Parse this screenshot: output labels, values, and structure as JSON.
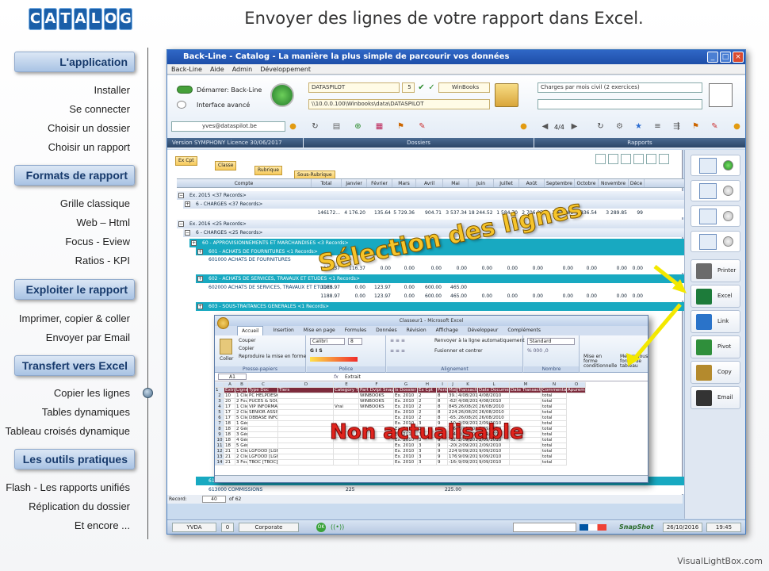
{
  "logo": {
    "letters": [
      "C",
      "A",
      "T",
      "A",
      "L",
      "O",
      "G"
    ]
  },
  "page_title": "Envoyer des lignes de votre rapport dans Excel.",
  "sidebar": {
    "sections": [
      {
        "title": "L'application",
        "items": [
          "Installer",
          "Se connecter",
          "Choisir un dossier",
          "Choisir un rapport"
        ]
      },
      {
        "title": "Formats de rapport",
        "items": [
          "Grille classique",
          "Web – Html",
          "Focus - Eview",
          "Ratios - KPI"
        ]
      },
      {
        "title": "Exploiter le rapport",
        "items": [
          "Imprimer, copier & coller",
          "Envoyer par Email"
        ]
      },
      {
        "title": "Transfert vers Excel",
        "items": [
          "Copier les lignes",
          "Tables dynamiques",
          "Tableau croisés dynamique"
        ]
      },
      {
        "title": "Les outils pratiques",
        "items": [
          "Flash - Les rapports unifiés",
          "Réplication du dossier",
          "Et encore ..."
        ]
      }
    ]
  },
  "app": {
    "title": "Back-Line - Catalog - La manière la plus simple de parcourir vos données",
    "menu": [
      "Back-Line",
      "Aide",
      "Admin",
      "Développement"
    ],
    "toggle_start": "Démarrer: Back-Line",
    "toggle_advanced": "Interface avancé",
    "email": "yves@dataspilot.be",
    "version": "Version SYMPHONY   Licence 30/06/2017",
    "dossier_name": "DATASPILOT",
    "dossier_num": "5",
    "dossier_soft": "WinBooks",
    "dossier_path": "\\\\10.0.0.100\\Winbooks\\data\\DATASPILOT",
    "report_name": "Charges par mois civil (2 exercices)",
    "report_page": "4/4",
    "section_dossiers": "Dossiers",
    "section_rapports": "Rapports",
    "group_tabs": [
      "Ex Cpt",
      "Classe",
      "Rubrique",
      "Sous-Rubrique"
    ],
    "columns": [
      "Compte",
      "Total",
      "Janvier",
      "Février",
      "Mars",
      "Avril",
      "Mai",
      "Juin",
      "Juillet",
      "Août",
      "Septembre",
      "Octobre",
      "Novembre",
      "Déce"
    ],
    "rows": [
      {
        "cls": "g1",
        "indent": 0,
        "text": "Ex. 2015  <37 Records>"
      },
      {
        "cls": "g1",
        "indent": 8,
        "text": "6 - CHARGES  <37 Records>"
      },
      {
        "cls": "g3",
        "indent": 8,
        "text": ""
      },
      {
        "cls": "g1",
        "indent": 0,
        "text": "Ex. 2016  <25 Records>"
      },
      {
        "cls": "g1",
        "indent": 8,
        "text": "6 - CHARGES  <25 Records>"
      },
      {
        "cls": "g2",
        "indent": 16,
        "text": "60 - APPROVISIONNEMENTS ET MARCHANDISES  <3 Records>"
      },
      {
        "cls": "g2",
        "indent": 24,
        "text": "601 - ACHATS DE FOURNITURES  <1 Records>"
      },
      {
        "cls": "g3",
        "indent": 24,
        "text": "601000 ACHATS DE FOURNITURES"
      },
      {
        "cls": "g3",
        "indent": 24,
        "text": ""
      },
      {
        "cls": "g2",
        "indent": 24,
        "text": "602 - ACHATS DE SERVICES, TRAVAUX ET ETUDES  <1 Records>"
      },
      {
        "cls": "g3",
        "indent": 24,
        "text": "602000 ACHATS DE SERVICES, TRAVAUX ET ETUDES"
      },
      {
        "cls": "g3",
        "indent": 24,
        "text": ""
      },
      {
        "cls": "g2",
        "indent": 24,
        "text": "603 - SOUS-TRAITANCES GENERALES  <1 Records>"
      }
    ],
    "row_values": [
      {
        "row": 2,
        "vals": [
          "146172...",
          "4 176.20",
          "135.64",
          "5 729.36",
          "904.71",
          "3 537.34",
          "18 244.52",
          "1 584.70",
          "2 706.87",
          "2 628.61",
          "3 836.54",
          "3 289.85",
          "99"
        ]
      },
      {
        "row": 8,
        "vals": [
          "116.37",
          "116.37",
          "0.00",
          "0.00",
          "0.00",
          "0.00",
          "0.00",
          "0.00",
          "0.00",
          "0.00",
          "0.00",
          "0.00",
          "0.00"
        ]
      },
      {
        "row": 10,
        "vals": [
          "1188.97",
          "0.00",
          "123.97",
          "0.00",
          "600.00",
          "465.00"
        ]
      },
      {
        "row": 11,
        "vals": [
          "1188.97",
          "0.00",
          "123.97",
          "0.00",
          "600.00",
          "465.00",
          "0.00",
          "0.00",
          "0.00",
          "0.00",
          "0.00",
          "0.00",
          "0.00"
        ]
      }
    ],
    "bottom_rows": [
      {
        "text": "613 - RETRIBUTIONS DE TIERS  <5 Records>"
      },
      {
        "text": "613000 COMMISSIONS",
        "v1": "225",
        "v2": "225.00"
      }
    ],
    "record_label": "Record:",
    "record_value": "40",
    "record_of": "of 62",
    "status": {
      "user": "YVDA",
      "num": "0",
      "env": "Corporate",
      "snapshot": "SnapShot",
      "date": "26/10/2016",
      "time": "19:45"
    },
    "right_buttons": [
      {
        "label": "Printer",
        "color": "#6b6b6b"
      },
      {
        "label": "Excel",
        "color": "#1d7b3a"
      },
      {
        "label": "Link",
        "color": "#2a73c9"
      },
      {
        "label": "Pivot",
        "color": "#2f8f3b"
      },
      {
        "label": "Copy",
        "color": "#b48a2d"
      },
      {
        "label": "Email",
        "color": "#333333"
      }
    ],
    "format_switches": [
      {
        "icon": "grid-icon",
        "on": true
      },
      {
        "icon": "html-icon",
        "on": false
      },
      {
        "icon": "xlsx-icon",
        "on": false
      },
      {
        "icon": "html-export-icon",
        "on": false
      }
    ]
  },
  "excel": {
    "title": "Classeur1 - Microsoft Excel",
    "tabs": [
      "Accueil",
      "Insertion",
      "Mise en page",
      "Formules",
      "Données",
      "Révision",
      "Affichage",
      "Développeur",
      "Compléments"
    ],
    "ribbon": {
      "clipboard": [
        "Couper",
        "Copier",
        "Reproduire la mise en forme"
      ],
      "paste": "Coller",
      "group_clipboard": "Presse-papiers",
      "font_name": "Calibri",
      "font_size": "8",
      "group_font": "Police",
      "wrap": "Renvoyer à la ligne automatiquement",
      "merge": "Fusionner et centrer",
      "group_align": "Alignement",
      "number_fmt": "Standard",
      "group_number": "Nombre",
      "cond_fmt": "Mise en forme conditionnelle",
      "style": "Mettre sous forme de tableau"
    },
    "cell_ref": "A1",
    "formula": "Extrait",
    "col_letters": [
      "",
      "A",
      "B",
      "C",
      "D",
      "E",
      "F",
      "G",
      "H",
      "I",
      "J",
      "K",
      "L",
      "M",
      "N",
      "O"
    ],
    "header": [
      "Extrait",
      "Ligne",
      "Type Doc",
      "Tiers",
      "Category Tiers",
      "Part Dvlpt Snapshot",
      "Is Dossier",
      "Ex Cpt",
      "Période",
      "Mois",
      "Transaction",
      "Date Document",
      "Date Transaction",
      "Commentaire",
      "Apurement"
    ],
    "rows": [
      [
        "2",
        "10",
        "1 Clients",
        "PC HELPDESK [PCHELPDESK]",
        "",
        "",
        "WINBOOKS",
        "Ex. 2010",
        "2",
        "8",
        "39.33",
        "4/08/2010",
        "4/08/2010",
        "",
        "total"
      ],
      [
        "3",
        "20",
        "2 Fournisseurs",
        "PUCES & SOURIS [PUCES]",
        "",
        "",
        "WINBOOKS",
        "Ex. 2010",
        "2",
        "8",
        "-629.2",
        "4/08/2010",
        "4/08/2010",
        "",
        "total"
      ],
      [
        "4",
        "17",
        "1 Clients",
        "VIP INFORMATICS [VIPINFO]",
        "",
        "Vrai",
        "WINBOOKS",
        "Ex. 2010",
        "2",
        "8",
        "845.49",
        "26/08/2010",
        "26/08/2010",
        "",
        "total"
      ],
      [
        "5",
        "17",
        "2 Clients",
        "SENIOR ASSIST [SENIOR]",
        "",
        "",
        "",
        "Ex. 2010",
        "2",
        "8",
        "2246.31",
        "26/08/2010",
        "26/08/2010",
        "",
        "total"
      ],
      [
        "6",
        "17",
        "5 Clients",
        "DBBASE INFORMATIQUE",
        "",
        "",
        "",
        "Ex. 2010",
        "2",
        "8",
        "-65.35",
        "26/08/2010",
        "26/08/2010",
        "",
        "total"
      ],
      [
        "7",
        "18",
        "1 Général",
        "",
        "",
        "",
        "",
        "Ex. 2010",
        "3",
        "9",
        "-10.42",
        "2/09/2010",
        "2/09/2010",
        "",
        "total"
      ],
      [
        "8",
        "18",
        "2 Général",
        "",
        "",
        "",
        "",
        "Ex. 2010",
        "3",
        "9",
        "-16.24",
        "2/09/2010",
        "2/09/2010",
        "",
        "total"
      ],
      [
        "9",
        "18",
        "3 Général",
        "",
        "",
        "",
        "",
        "Ex. 2010",
        "3",
        "9",
        "-146.74",
        "2/09/2010",
        "2/09/2010",
        "",
        "total"
      ],
      [
        "10",
        "18",
        "4 Général",
        "",
        "",
        "",
        "",
        "Ex. 2010",
        "3",
        "9",
        "-52.5",
        "2/09/2010",
        "2/09/2010",
        "",
        "total"
      ],
      [
        "11",
        "18",
        "5 Général",
        "",
        "",
        "",
        "",
        "Ex. 2010",
        "3",
        "9",
        "-208.69",
        "2/09/2010",
        "2/09/2010",
        "",
        "total"
      ],
      [
        "12",
        "21",
        "1 Clients",
        "LGFOOD [LGFOOD]",
        "",
        "",
        "",
        "Ex. 2010",
        "3",
        "9",
        "2249.09",
        "9/09/2010",
        "9/09/2010",
        "",
        "total"
      ],
      [
        "13",
        "21",
        "2 Clients",
        "LGFOOD [LGFOOD]",
        "",
        "",
        "",
        "Ex. 2010",
        "3",
        "9",
        "176.96",
        "9/09/2010",
        "9/09/2010",
        "",
        "total"
      ],
      [
        "14",
        "21",
        "3 Fournisseurs",
        "TBOC [TBOC]",
        "",
        "",
        "",
        "Ex. 2010",
        "3",
        "9",
        "-164",
        "9/09/2010",
        "9/09/2010",
        "",
        "total"
      ]
    ]
  },
  "overlays": {
    "selection": "Sélection des lignes",
    "not_refreshable": "Non actualisable"
  },
  "watermark": "VisualLightBox.com"
}
